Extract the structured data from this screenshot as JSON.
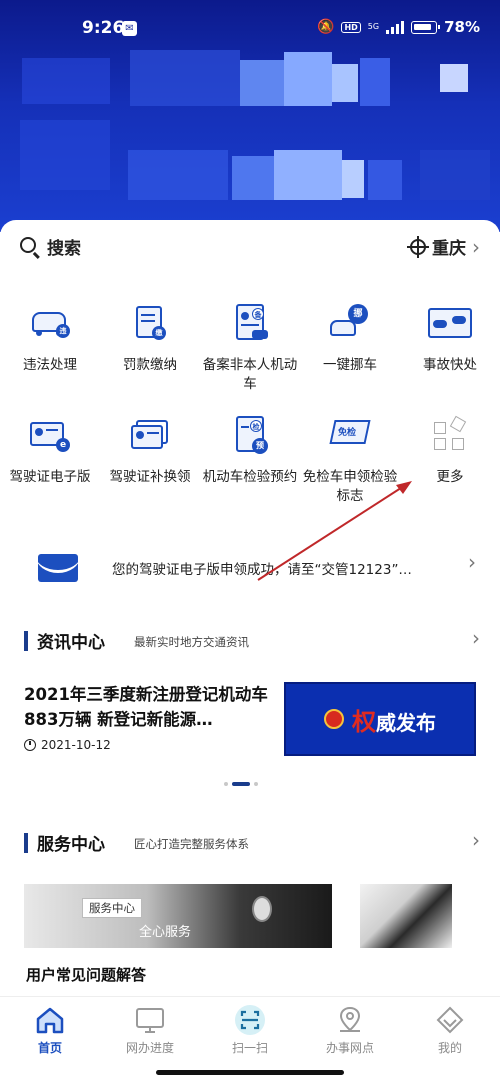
{
  "status_bar": {
    "time": "9:26",
    "notification_badge": "ⓢ",
    "network_label": "5G",
    "hd_label": "HD",
    "battery": "78%"
  },
  "search": {
    "label": "搜索",
    "city": "重庆"
  },
  "services": [
    {
      "label": "违法处理",
      "icon": "car-violation-icon"
    },
    {
      "label": "罚款缴纳",
      "icon": "fine-payment-icon"
    },
    {
      "label": "备案非本人机动车",
      "icon": "vehicle-registration-icon"
    },
    {
      "label": "一键挪车",
      "icon": "move-car-icon"
    },
    {
      "label": "事故快处",
      "icon": "accident-icon"
    },
    {
      "label": "驾驶证电子版",
      "icon": "e-license-icon"
    },
    {
      "label": "驾驶证补换领",
      "icon": "license-renew-icon"
    },
    {
      "label": "机动车检验预约",
      "icon": "inspection-booking-icon"
    },
    {
      "label": "免检车申领检验标志",
      "icon": "exempt-inspection-icon",
      "badge": "免检"
    },
    {
      "label": "更多",
      "icon": "more-icon"
    }
  ],
  "service_badges": {
    "violation": "违",
    "fine": "缴",
    "registration": "备",
    "move": "挪",
    "elicense": "e",
    "inspection": "预",
    "inspection_doc": "检"
  },
  "notice": {
    "text": "您的驾驶证电子版申领成功，请至“交管12123”…"
  },
  "news_section": {
    "title": "资讯中心",
    "subtitle": "最新实时地方交通资讯",
    "article_title": "2021年三季度新注册登记机动车883万辆 新登记新能源…",
    "article_date": "2021-10-12",
    "banner_text_highlight": "权",
    "banner_text": "威发布"
  },
  "service_section": {
    "title": "服务中心",
    "subtitle": "匠心打造完整服务体系",
    "image_tag": "服务中心",
    "image_caption": "全心服务",
    "faq_title": "用户常见问题解答"
  },
  "tabs": [
    {
      "label": "首页",
      "active": true
    },
    {
      "label": "网办进度",
      "active": false
    },
    {
      "label": "扫一扫",
      "active": false
    },
    {
      "label": "办事网点",
      "active": false
    },
    {
      "label": "我的",
      "active": false
    }
  ],
  "colors": {
    "brand_blue": "#1c4fbf",
    "header_blue": "#1530b8",
    "annotation_red": "#c0282a"
  }
}
